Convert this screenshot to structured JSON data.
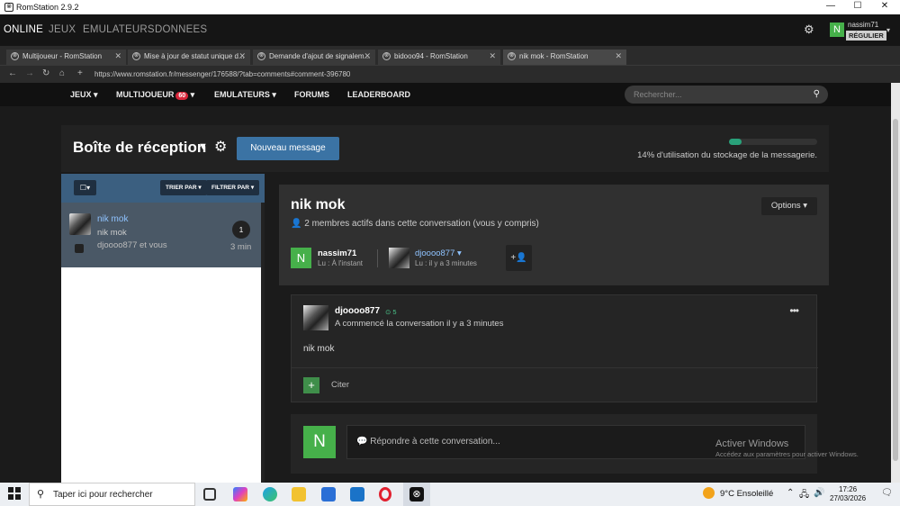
{
  "window": {
    "title": "RomStation 2.9.2"
  },
  "appbar": {
    "nav": [
      "ONLINE",
      "JEUX",
      "EMULATEURS",
      "DONNEES"
    ],
    "username": "nassim71",
    "rank": "RÉGULIER",
    "avatar_letter": "N"
  },
  "tabs": [
    {
      "label": "Multijoueur - RomStation"
    },
    {
      "label": "Mise à jour de statut unique d..."
    },
    {
      "label": "Demande d'ajout de signalem..."
    },
    {
      "label": "bidooo94 - RomStation"
    },
    {
      "label": "nik mok - RomStation"
    }
  ],
  "url": "https://www.romstation.fr/messenger/176588/?tab=comments#comment-396780",
  "sitenav": {
    "jeux": "JEUX",
    "multijoueur": "MULTIJOUEUR",
    "multi_badge": "60",
    "emulateurs": "EMULATEURS",
    "forums": "FORUMS",
    "leaderboard": "LEADERBOARD",
    "search_placeholder": "Rechercher..."
  },
  "inbox": {
    "title": "Boîte de réception",
    "new_message": "Nouveau message",
    "storage_text": "14% d'utilisation du stockage de la messagerie.",
    "storage_fraction": 0.14
  },
  "list": {
    "sort": "TRIER PAR",
    "filter": "FILTRER PAR",
    "items": [
      {
        "name": "nik mok",
        "subject": "nik mok",
        "participants": "djoooo877 et vous",
        "count": "1",
        "time": "3 min"
      }
    ]
  },
  "conversation": {
    "title": "nik mok",
    "options": "Options",
    "members": "2 membres actifs dans cette conversation (vous y compris)",
    "participants": [
      {
        "name": "nassim71",
        "read": "Lu : À l'instant",
        "avatar_letter": "N"
      },
      {
        "name": "djoooo877",
        "read": "Lu : il y a 3 minutes"
      }
    ]
  },
  "post": {
    "author": "djoooo877",
    "reputation": "5",
    "status": "A commencé la conversation il y a 3 minutes",
    "body": "nik mok",
    "quote": "Citer"
  },
  "reply": {
    "avatar_letter": "N",
    "placeholder": "Répondre à cette conversation..."
  },
  "watermark": {
    "title": "Activer Windows",
    "sub": "Accédez aux paramètres pour activer Windows."
  },
  "taskbar": {
    "search": "Taper ici pour rechercher",
    "weather": "9°C  Ensoleillé",
    "time": "17:26",
    "date": "27/03/2026"
  }
}
